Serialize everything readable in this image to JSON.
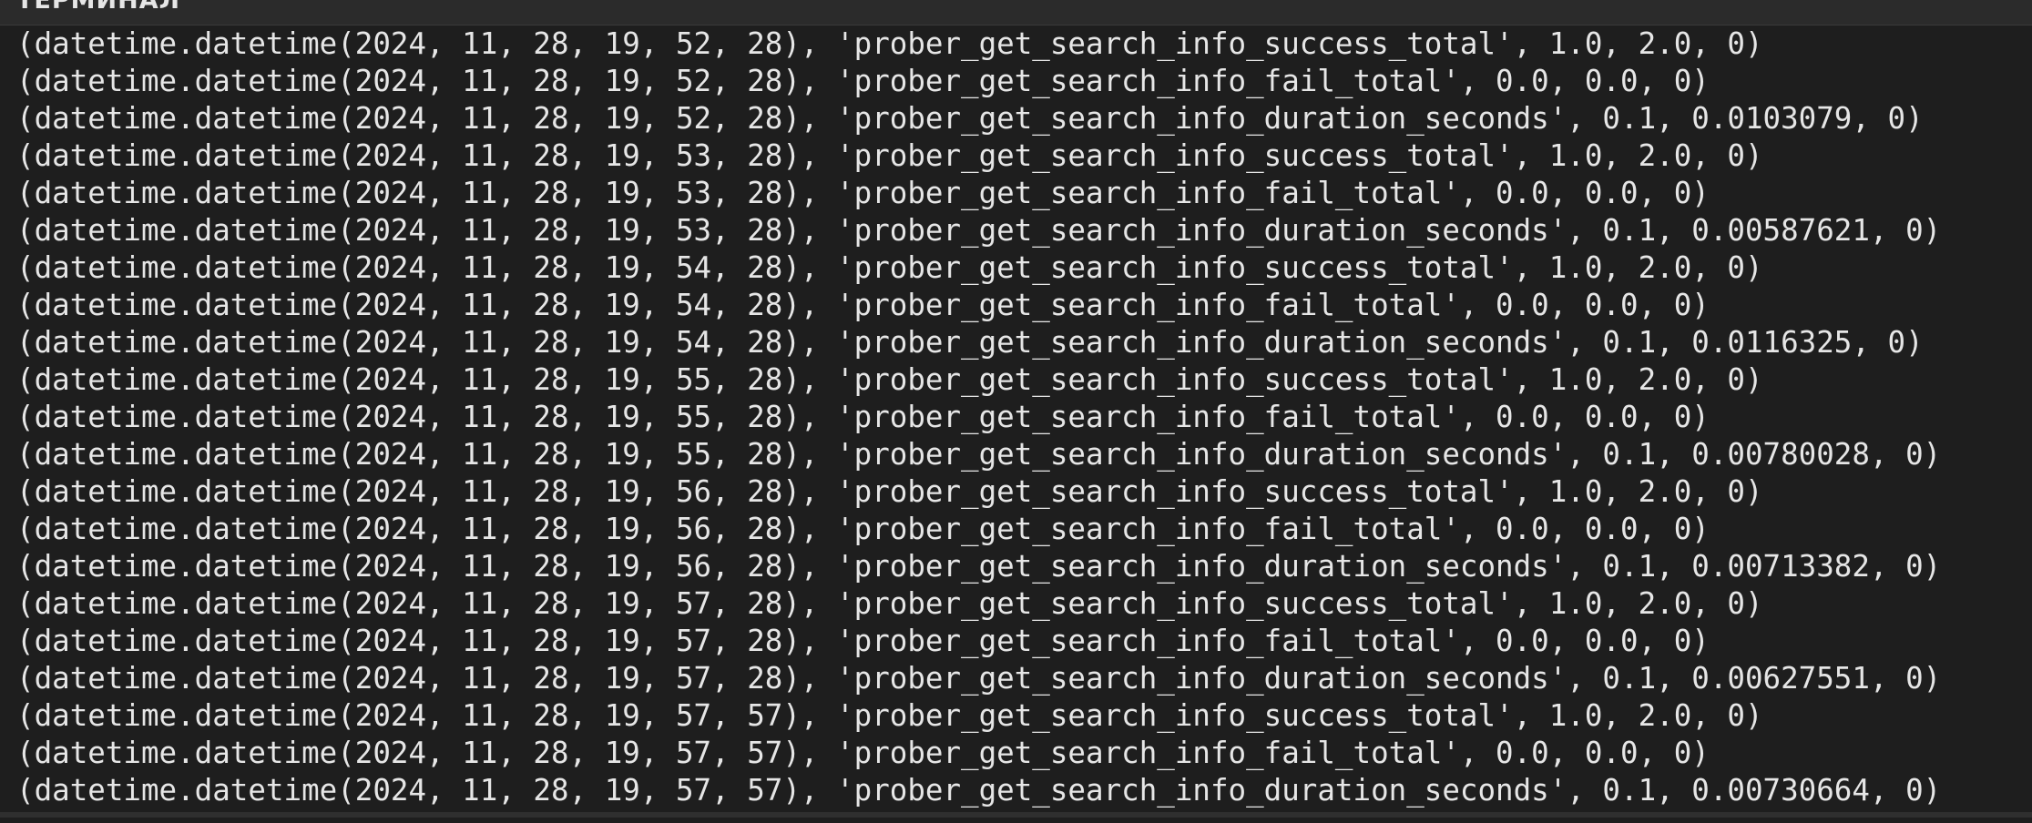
{
  "panel": {
    "title": "ТЕРМИНАЛ"
  },
  "terminal": {
    "lines": [
      "(datetime.datetime(2024, 11, 28, 19, 52, 28), 'prober_get_search_info_success_total', 1.0, 2.0, 0)",
      "(datetime.datetime(2024, 11, 28, 19, 52, 28), 'prober_get_search_info_fail_total', 0.0, 0.0, 0)",
      "(datetime.datetime(2024, 11, 28, 19, 52, 28), 'prober_get_search_info_duration_seconds', 0.1, 0.0103079, 0)",
      "(datetime.datetime(2024, 11, 28, 19, 53, 28), 'prober_get_search_info_success_total', 1.0, 2.0, 0)",
      "(datetime.datetime(2024, 11, 28, 19, 53, 28), 'prober_get_search_info_fail_total', 0.0, 0.0, 0)",
      "(datetime.datetime(2024, 11, 28, 19, 53, 28), 'prober_get_search_info_duration_seconds', 0.1, 0.00587621, 0)",
      "(datetime.datetime(2024, 11, 28, 19, 54, 28), 'prober_get_search_info_success_total', 1.0, 2.0, 0)",
      "(datetime.datetime(2024, 11, 28, 19, 54, 28), 'prober_get_search_info_fail_total', 0.0, 0.0, 0)",
      "(datetime.datetime(2024, 11, 28, 19, 54, 28), 'prober_get_search_info_duration_seconds', 0.1, 0.0116325, 0)",
      "(datetime.datetime(2024, 11, 28, 19, 55, 28), 'prober_get_search_info_success_total', 1.0, 2.0, 0)",
      "(datetime.datetime(2024, 11, 28, 19, 55, 28), 'prober_get_search_info_fail_total', 0.0, 0.0, 0)",
      "(datetime.datetime(2024, 11, 28, 19, 55, 28), 'prober_get_search_info_duration_seconds', 0.1, 0.00780028, 0)",
      "(datetime.datetime(2024, 11, 28, 19, 56, 28), 'prober_get_search_info_success_total', 1.0, 2.0, 0)",
      "(datetime.datetime(2024, 11, 28, 19, 56, 28), 'prober_get_search_info_fail_total', 0.0, 0.0, 0)",
      "(datetime.datetime(2024, 11, 28, 19, 56, 28), 'prober_get_search_info_duration_seconds', 0.1, 0.00713382, 0)",
      "(datetime.datetime(2024, 11, 28, 19, 57, 28), 'prober_get_search_info_success_total', 1.0, 2.0, 0)",
      "(datetime.datetime(2024, 11, 28, 19, 57, 28), 'prober_get_search_info_fail_total', 0.0, 0.0, 0)",
      "(datetime.datetime(2024, 11, 28, 19, 57, 28), 'prober_get_search_info_duration_seconds', 0.1, 0.00627551, 0)",
      "(datetime.datetime(2024, 11, 28, 19, 57, 57), 'prober_get_search_info_success_total', 1.0, 2.0, 0)",
      "(datetime.datetime(2024, 11, 28, 19, 57, 57), 'prober_get_search_info_fail_total', 0.0, 0.0, 0)",
      "(datetime.datetime(2024, 11, 28, 19, 57, 57), 'prober_get_search_info_duration_seconds', 0.1, 0.00730664, 0)"
    ]
  },
  "colors": {
    "background": "#1e1e1e",
    "header_background": "#2b2b2b",
    "text": "#e6e6e6"
  }
}
